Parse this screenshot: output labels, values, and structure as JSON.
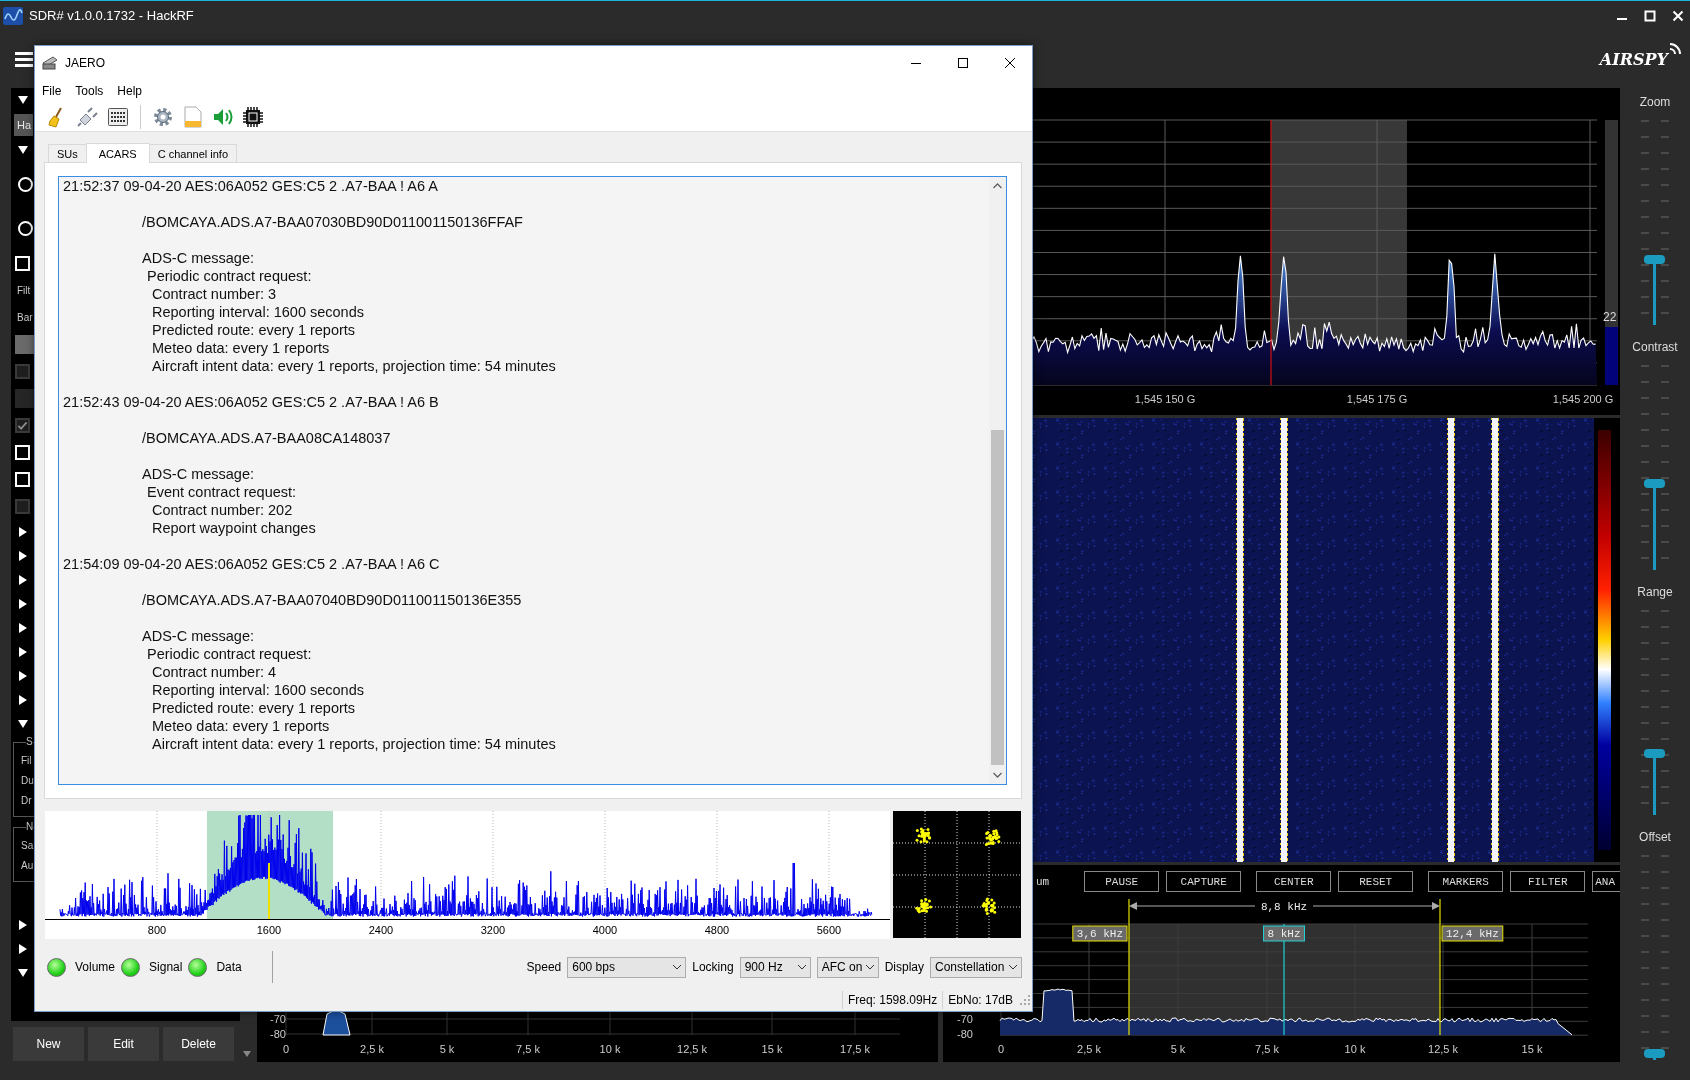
{
  "sdr": {
    "title": "SDR# v1.0.0.1732 - HackRF",
    "logo": "AIRSPY",
    "panel_rows": [
      {
        "kind": "section",
        "expanded": true
      },
      {
        "kind": "field",
        "value": "Ha"
      },
      {
        "kind": "section",
        "expanded": true
      },
      {
        "kind": "radio",
        "selected": false
      },
      {
        "kind": "radio",
        "selected": false
      },
      {
        "kind": "checkbox",
        "checked": false,
        "disabled": false
      },
      {
        "kind": "label",
        "text": "Filt"
      },
      {
        "kind": "label",
        "text": "Bar"
      },
      {
        "kind": "block",
        "disabled": false
      },
      {
        "kind": "checkbox",
        "checked": false,
        "disabled": true
      },
      {
        "kind": "block",
        "disabled": true
      },
      {
        "kind": "checkbox",
        "checked": true,
        "disabled": true
      },
      {
        "kind": "checkbox",
        "checked": false,
        "disabled": false
      },
      {
        "kind": "checkbox",
        "checked": false,
        "disabled": false
      },
      {
        "kind": "checkbox",
        "checked": false,
        "disabled": true
      },
      {
        "kind": "section",
        "expanded": false
      },
      {
        "kind": "section",
        "expanded": false
      },
      {
        "kind": "section",
        "expanded": false
      },
      {
        "kind": "section",
        "expanded": false
      },
      {
        "kind": "section",
        "expanded": false
      },
      {
        "kind": "section",
        "expanded": false
      },
      {
        "kind": "section",
        "expanded": false
      },
      {
        "kind": "section",
        "expanded": false
      },
      {
        "kind": "section",
        "expanded": true
      },
      {
        "kind": "group",
        "title": "S",
        "labels": [
          "Fil",
          "Du",
          "Dr"
        ]
      },
      {
        "kind": "group",
        "title": "N",
        "labels": [
          "Sa",
          "Au"
        ]
      },
      {
        "kind": "section",
        "expanded": false
      },
      {
        "kind": "section",
        "expanded": false
      },
      {
        "kind": "section",
        "expanded": true
      }
    ],
    "panel_buttons": [
      "New",
      "Edit",
      "Delete"
    ],
    "spectrum": {
      "freq_labels": [
        "1,545 150 G",
        "1,545 175 G",
        "1,545 200 G"
      ],
      "meter": {
        "reading": "22",
        "level": 0.22
      }
    },
    "audio_spectrum": {
      "y_labels": [
        "-70",
        "-80"
      ],
      "x_labels": [
        "0",
        "2,5 k",
        "5 k",
        "7,5 k",
        "10 k",
        "12,5 k",
        "15 k",
        "17,5 k"
      ]
    },
    "fft_panel": {
      "title": "um",
      "buttons": [
        "PAUSE",
        "CAPTURE",
        "CENTER",
        "RESET",
        "MARKERS",
        "FILTER",
        "ANA"
      ],
      "bandwidth": "8,8 kHz",
      "markers": [
        {
          "label": "3,6 kHz",
          "kind": "edge"
        },
        {
          "label": "8 kHz",
          "kind": "center"
        },
        {
          "label": "12,4 kHz",
          "kind": "edge"
        }
      ],
      "y_labels": [
        "-70",
        "-80"
      ],
      "x_labels": [
        "0",
        "2,5 k",
        "5 k",
        "7,5 k",
        "10 k",
        "12,5 k",
        "15 k"
      ]
    },
    "sliders": [
      {
        "label": "Zoom",
        "level": 0.31
      },
      {
        "label": "Contrast",
        "level": 0.42
      },
      {
        "label": "Range",
        "level": 0.29
      },
      {
        "label": "Offset",
        "level": 0.01
      }
    ]
  },
  "jaero": {
    "title": "JAERO",
    "menu": [
      "File",
      "Tools",
      "Help"
    ],
    "tabs": [
      {
        "label": "SUs",
        "selected": false
      },
      {
        "label": "ACARS",
        "selected": true
      },
      {
        "label": "C channel info",
        "selected": false
      }
    ],
    "messages": [
      {
        "header": "21:52:37 09-04-20 AES:06A052 GES:C5 2 .A7-BAA ! A6 A",
        "route": "/BOMCAYA.ADS.A7-BAA07030BD90D011001150136FFAF",
        "body": {
          "text": "ADS-C message:",
          "children": [
            {
              "text": "Periodic contract request:",
              "children": [
                {
                  "text": "Contract number: 3"
                },
                {
                  "text": "Reporting interval: 1600 seconds"
                },
                {
                  "text": "Predicted route: every 1 reports"
                },
                {
                  "text": "Meteo data: every 1 reports"
                },
                {
                  "text": "Aircraft intent data: every 1 reports, projection time: 54 minutes"
                }
              ]
            }
          ]
        }
      },
      {
        "header": "21:52:43 09-04-20 AES:06A052 GES:C5 2 .A7-BAA ! A6 B",
        "route": "/BOMCAYA.ADS.A7-BAA08CA148037",
        "body": {
          "text": "ADS-C message:",
          "children": [
            {
              "text": "Event contract request:",
              "children": [
                {
                  "text": "Contract number: 202"
                },
                {
                  "text": "Report waypoint changes"
                }
              ]
            }
          ]
        }
      },
      {
        "header": "21:54:09 09-04-20 AES:06A052 GES:C5 2 .A7-BAA ! A6 C",
        "route": "/BOMCAYA.ADS.A7-BAA07040BD90D011001150136E355",
        "body": {
          "text": "ADS-C message:",
          "children": [
            {
              "text": "Periodic contract request:",
              "children": [
                {
                  "text": "Contract number: 4"
                },
                {
                  "text": "Reporting interval: 1600 seconds"
                },
                {
                  "text": "Predicted route: every 1 reports"
                },
                {
                  "text": "Meteo data: every 1 reports"
                },
                {
                  "text": "Aircraft intent data: every 1 reports, projection time: 54 minutes"
                }
              ]
            }
          ]
        }
      }
    ],
    "spectrum": {
      "x_labels": [
        "800",
        "1600",
        "2400",
        "3200",
        "4000",
        "4800",
        "5600"
      ]
    },
    "indicators": [
      {
        "label": "Volume",
        "on": true
      },
      {
        "label": "Signal",
        "on": true
      },
      {
        "label": "Data",
        "on": true
      }
    ],
    "settings": [
      {
        "label": "Speed",
        "value": "600 bps"
      },
      {
        "label": "Locking",
        "value": "900 Hz"
      },
      {
        "value": "AFC on"
      },
      {
        "label": "Display",
        "value": "Constellation"
      }
    ],
    "status": [
      "Freq: 1598.09Hz",
      "EbNo: 17dB"
    ]
  }
}
